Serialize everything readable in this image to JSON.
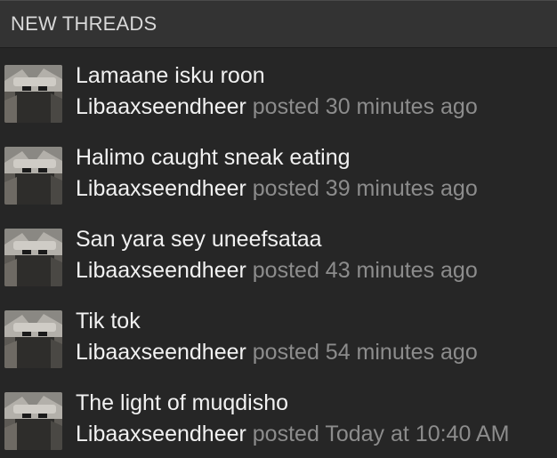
{
  "header": {
    "title": "NEW THREADS"
  },
  "threads": [
    {
      "title": "Lamaane isku roon",
      "author": "Libaaxseendheer",
      "posted_word": "posted",
      "time": "30 minutes ago"
    },
    {
      "title": "Halimo caught sneak eating",
      "author": "Libaaxseendheer",
      "posted_word": "posted",
      "time": "39 minutes ago"
    },
    {
      "title": "San yara sey uneefsataa",
      "author": "Libaaxseendheer",
      "posted_word": "posted",
      "time": "43 minutes ago"
    },
    {
      "title": "Tik tok",
      "author": "Libaaxseendheer",
      "posted_word": "posted",
      "time": "54 minutes ago"
    },
    {
      "title": "The light of muqdisho",
      "author": "Libaaxseendheer",
      "posted_word": "posted",
      "time": "Today at 10:40 AM"
    }
  ],
  "colors": {
    "panel_bg": "#262626",
    "header_bg": "#333333",
    "title_text": "#f1f1f1",
    "muted_text": "#8c8c8c"
  },
  "icons": {
    "avatar": "user-avatar-image"
  }
}
